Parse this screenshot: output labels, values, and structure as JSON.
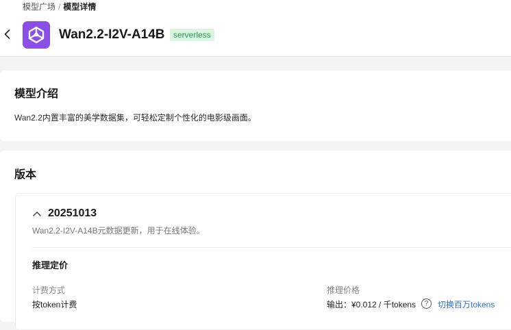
{
  "breadcrumb": {
    "parent": "模型广场",
    "separator": "/",
    "current": "模型详情"
  },
  "header": {
    "model_name": "Wan2.2-I2V-A14B",
    "badge": "serverless",
    "logo_icon": "qwen-logo-icon",
    "logo_color": "#8a4fe8"
  },
  "intro": {
    "title": "模型介绍",
    "text": "Wan2.2内置丰富的美学数据集，可轻松定制个性化的电影级画面。"
  },
  "versions": {
    "title": "版本",
    "items": [
      {
        "id": "20251013",
        "description": "Wan2.2-I2V-A14B元数据更新，用于在线体验。",
        "pricing": {
          "title": "推理定价",
          "billing_label": "计费方式",
          "billing_value": "按token计费",
          "price_label": "推理价格",
          "price_value": "输出：¥0.012 / 千tokens",
          "help_glyph": "?",
          "switch_link": "切换百万tokens"
        }
      }
    ]
  }
}
